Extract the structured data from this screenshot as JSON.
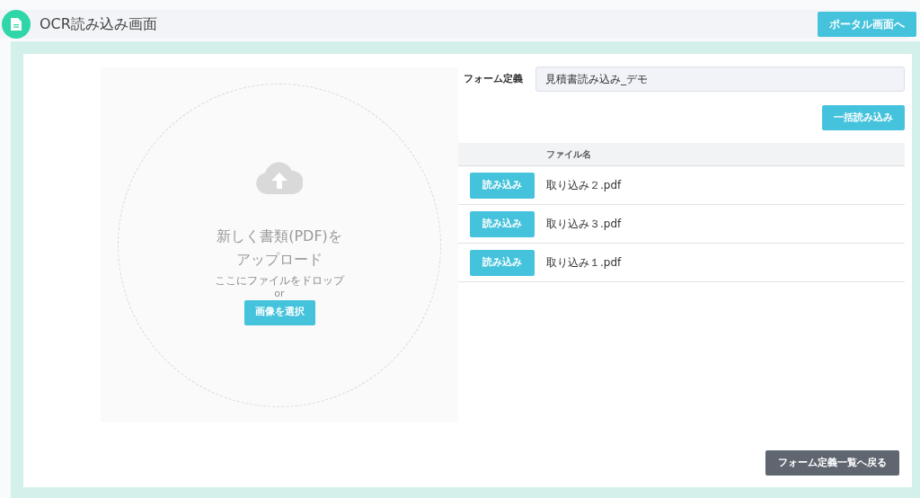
{
  "header": {
    "title": "OCR読み込み画面",
    "portal_button": "ポータル画面へ"
  },
  "upload": {
    "heading_lines": [
      "新しく書類(PDF)を",
      "アップロード"
    ],
    "hint": "ここにファイルをドロップ",
    "or": "or",
    "select_button": "画像を選択"
  },
  "form": {
    "label": "フォーム定義",
    "value": "見積書読み込み_デモ"
  },
  "batch_button": "一括読み込み",
  "table": {
    "columns": [
      "ファイル名"
    ],
    "rows": [
      {
        "button": "読み込み",
        "file": "取り込み２.pdf"
      },
      {
        "button": "読み込み",
        "file": "取り込み３.pdf"
      },
      {
        "button": "読み込み",
        "file": "取り込み１.pdf"
      }
    ]
  },
  "back_button": "フォーム定義一覧へ戻る"
}
